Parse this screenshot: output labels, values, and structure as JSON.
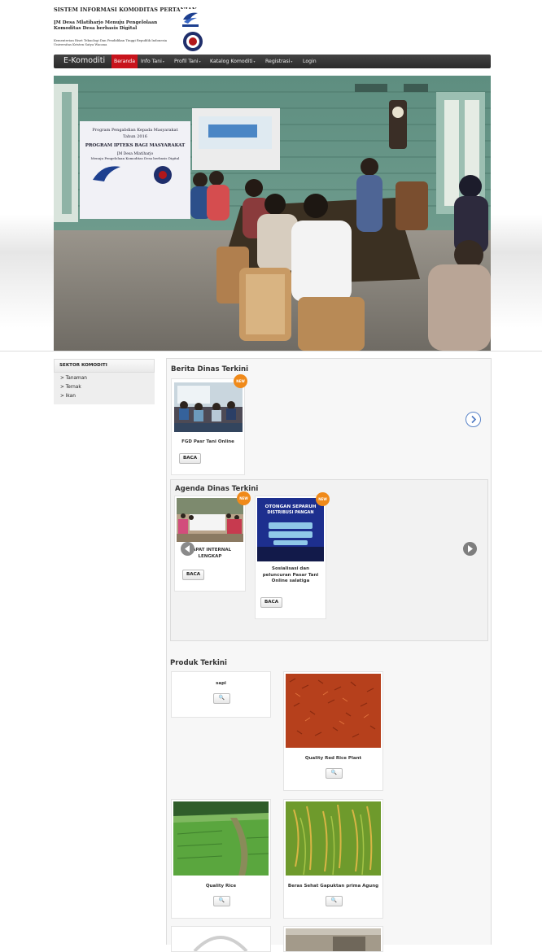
{
  "header": {
    "title": "SISTEM INFORMASI KOMODITAS PERTANIAN",
    "subtitle_1": "I̥M Desa Mlatiharjo Menuju Pengelolaan",
    "subtitle_2": "Komoditas Desa berbasis Digital",
    "ministry_1": "Kementerian Riset Teknologi Dan Pendidikan Tinggi Republik Indonesia",
    "ministry_2": "Universitas Kristen Satya Wacana"
  },
  "navbar": {
    "brand": "E-Komoditi",
    "items": [
      {
        "label": "Beranda",
        "active": true,
        "caret": false
      },
      {
        "label": "Info Tani",
        "active": false,
        "caret": true
      },
      {
        "label": "Profil Tani",
        "active": false,
        "caret": true
      },
      {
        "label": "Katalog Komoditi",
        "active": false,
        "caret": true
      },
      {
        "label": "Registrasi",
        "active": false,
        "caret": true
      },
      {
        "label": "Login",
        "active": false,
        "caret": false
      }
    ]
  },
  "hero": {
    "banner_1": "Program Pengabdian Kepada Masyarakat",
    "banner_2": "Tahun 2016",
    "banner_3": "PROGRAM IPTEKS BAGI MASYARAKAT",
    "banner_4": "I̥M Desa Mlatiharjo",
    "banner_5": "Menuju Pengelolaan Komoditas Desa berbasis Digital"
  },
  "sidebar": {
    "heading": "SEKTOR KOMODITI",
    "items": [
      "> Tanaman",
      "> Ternak",
      "> Ikan"
    ]
  },
  "berita": {
    "title": "Berita Dinas Terkini",
    "badge": "NEW",
    "card_title": "FGD Pasr Tani Online",
    "button": "BACA"
  },
  "agenda": {
    "title": "Agenda Dinas Terkini",
    "card1_title_1": "RAPAT INTERNAL",
    "card1_title_2": "LENGKAP",
    "card1_button": "BACA",
    "card2_title_1": "Sosialisasi dan",
    "card2_title_2": "peluncuran Pasar Tani",
    "card2_title_3": "Online salatiga",
    "card2_button": "BACA",
    "card2_image_text_1": "OTONGAN SEPARUH",
    "card2_image_text_2": "DISTRIBUSI PANGAN",
    "badge": "NEW"
  },
  "produk": {
    "title": "Produk Terkini",
    "items": [
      {
        "name": "sapi"
      },
      {
        "name": "Quality Red Rice Plant"
      },
      {
        "name": "Quality Rice"
      },
      {
        "name": "Beras Sehat Gapuktan prima Agung"
      }
    ],
    "zoom_icon": "magnifier-icon"
  }
}
